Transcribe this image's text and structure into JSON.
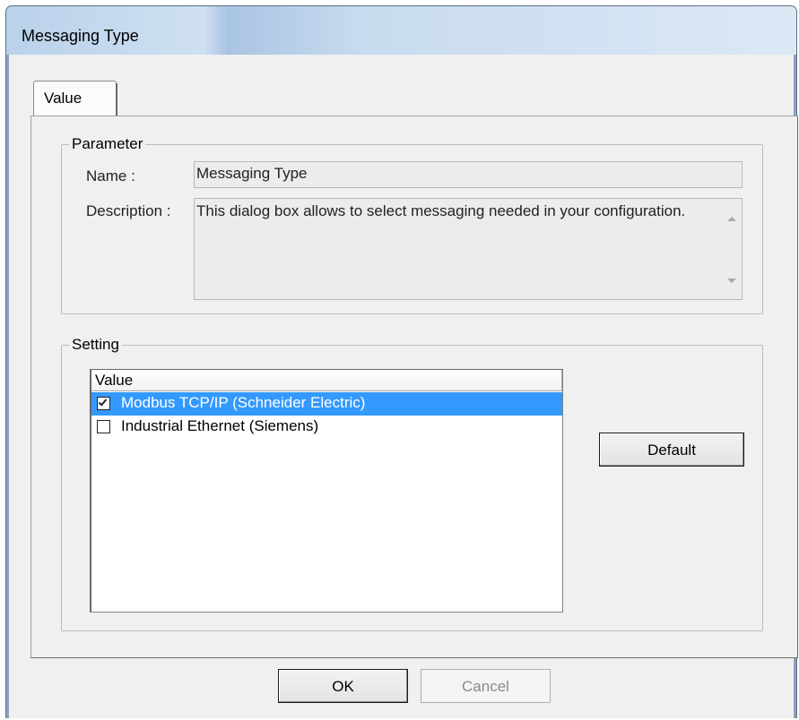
{
  "window": {
    "title": "Messaging Type"
  },
  "tabs": [
    {
      "label": "Value"
    }
  ],
  "parameter": {
    "group_label": "Parameter",
    "name_label": "Name :",
    "name_value": "Messaging Type",
    "description_label": "Description :",
    "description_value": "This dialog box allows to select messaging needed in your configuration."
  },
  "setting": {
    "group_label": "Setting",
    "list_header": "Value",
    "items": [
      {
        "label": "Modbus TCP/IP (Schneider Electric)",
        "checked": true,
        "selected": true
      },
      {
        "label": "Industrial Ethernet (Siemens)",
        "checked": false,
        "selected": false
      }
    ],
    "default_button": "Default"
  },
  "footer": {
    "ok_label": "OK",
    "cancel_label": "Cancel"
  },
  "colors": {
    "selection": "#3399ff",
    "dialog_background": "#f0f0f0"
  }
}
